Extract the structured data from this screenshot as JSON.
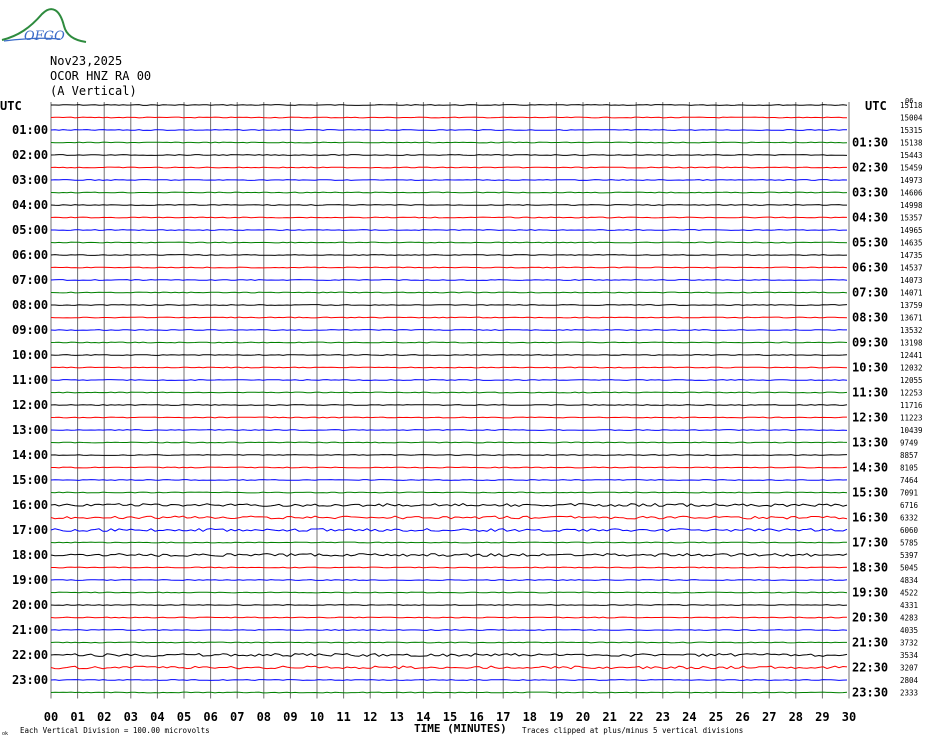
{
  "header": {
    "logo_text": "OFGO",
    "date": "Nov23,2025",
    "station": "OCOR HNZ RA 00",
    "component": "(A Vertical)"
  },
  "corner_labels": {
    "left": "UTC",
    "right": "UTC",
    "top_right": "06"
  },
  "footer": {
    "x_axis_title": "TIME (MINUTES)",
    "scale_note": "Each Vertical Division =  100.00 microvolts",
    "clip_note": "Traces clipped at plus/minus 5 vertical divisions",
    "corner_mark": "ok"
  },
  "colors": {
    "black": "#000000",
    "red": "#ff0000",
    "blue": "#0000ff",
    "green": "#008000",
    "grid": "#707070"
  },
  "chart_data": {
    "type": "line",
    "x_ticks": [
      "00",
      "01",
      "02",
      "03",
      "04",
      "05",
      "06",
      "07",
      "08",
      "09",
      "10",
      "11",
      "12",
      "13",
      "14",
      "15",
      "16",
      "17",
      "18",
      "19",
      "20",
      "21",
      "22",
      "23",
      "24",
      "25",
      "26",
      "27",
      "28",
      "29",
      "30"
    ],
    "xlim": [
      0,
      30
    ],
    "traces_per_hour": 4,
    "trace_color_cycle": [
      "black",
      "red",
      "blue",
      "green"
    ],
    "left_hour_labels": [
      "01:00",
      "02:00",
      "03:00",
      "04:00",
      "05:00",
      "06:00",
      "07:00",
      "08:00",
      "09:00",
      "10:00",
      "11:00",
      "12:00",
      "13:00",
      "14:00",
      "15:00",
      "16:00",
      "17:00",
      "18:00",
      "19:00",
      "20:00",
      "21:00",
      "22:00",
      "23:00"
    ],
    "right_hour_labels": [
      "01:30",
      "02:30",
      "03:30",
      "04:30",
      "05:30",
      "06:30",
      "07:30",
      "08:30",
      "09:30",
      "10:30",
      "11:30",
      "12:30",
      "13:30",
      "14:30",
      "15:30",
      "16:30",
      "17:30",
      "18:30",
      "19:30",
      "20:30",
      "21:30",
      "22:30",
      "23:30"
    ],
    "trace_offsets": [
      "15118",
      "15004",
      "15315",
      "15138",
      "15443",
      "15459",
      "14973",
      "14606",
      "14998",
      "15357",
      "14965",
      "14635",
      "14735",
      "14537",
      "14073",
      "14071",
      "13759",
      "13671",
      "13532",
      "13198",
      "12441",
      "12032",
      "12055",
      "12253",
      "11716",
      "11223",
      "10439",
      "9749",
      "8857",
      "8105",
      "7464",
      "7091",
      "6716",
      "6332",
      "6060",
      "5785",
      "5397",
      "5045",
      "4834",
      "4522",
      "4331",
      "4283",
      "4035",
      "3732",
      "3534",
      "3207",
      "2804",
      "2333"
    ],
    "noisy_traces": [
      32,
      33,
      34,
      36,
      44,
      45
    ]
  }
}
